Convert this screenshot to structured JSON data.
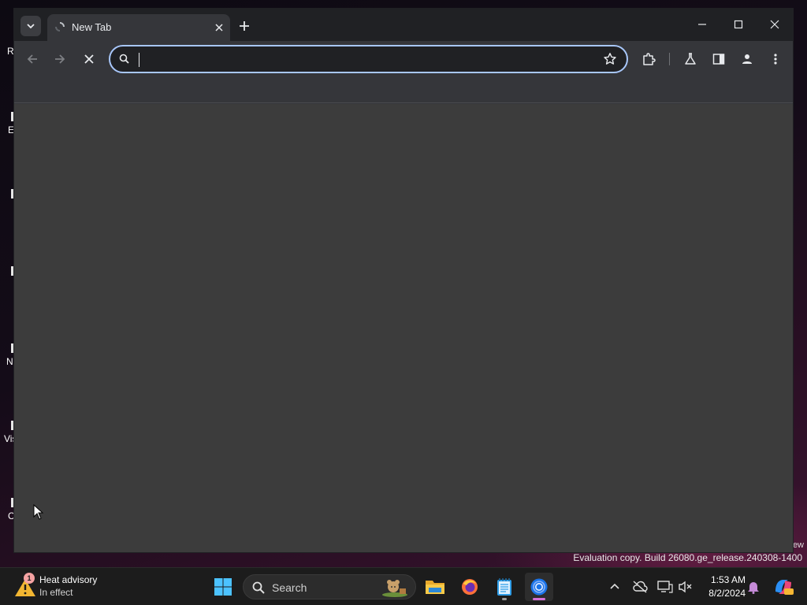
{
  "desktop": {
    "icons": [
      {
        "label": "R"
      },
      {
        "label": "E"
      },
      {
        "label": ""
      },
      {
        "label": ""
      },
      {
        "label": "N"
      },
      {
        "label": "Vis"
      },
      {
        "label": "C"
      }
    ],
    "edge_text": "ew",
    "watermark": "Evaluation copy. Build 26080.ge_release.240308-1400"
  },
  "browser": {
    "tab": {
      "title": "New Tab"
    },
    "omnibox": {
      "value": "",
      "placeholder": ""
    },
    "icons": {
      "back": "arrow-left-icon",
      "forward": "arrow-right-icon",
      "stop": "close-icon",
      "bookmark": "star-icon",
      "extensions": "puzzle-icon",
      "labs": "flask-icon",
      "side_panel": "side-panel-icon",
      "profile": "person-icon",
      "menu": "kebab-menu-icon"
    }
  },
  "taskbar": {
    "weather": {
      "title": "Heat advisory",
      "subtitle": "In effect",
      "badge": "1"
    },
    "search": {
      "label": "Search"
    },
    "apps": [
      "start",
      "file-explorer",
      "firefox",
      "notepad",
      "chrome"
    ],
    "clock": {
      "time": "1:53 AM",
      "date": "8/2/2024"
    }
  },
  "colors": {
    "accent": "#a8c7fa",
    "toolbar": "#35363a",
    "titlebar": "#202124",
    "content": "#3c3c3c"
  }
}
